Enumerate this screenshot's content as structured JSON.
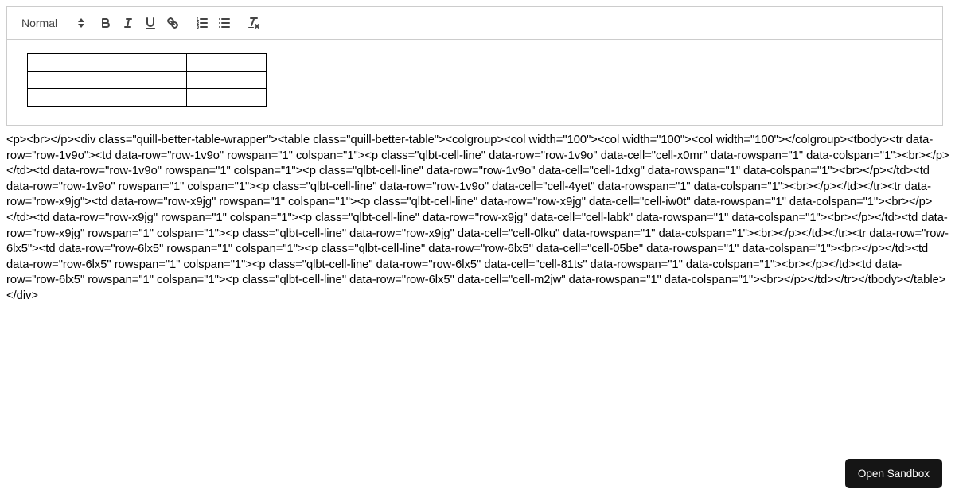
{
  "editor": {
    "toolbar": {
      "format_picker": {
        "label": "Normal",
        "icon": "chevron-updown-icon"
      },
      "buttons": [
        {
          "name": "bold",
          "label": "B",
          "icon": "bold-icon"
        },
        {
          "name": "italic",
          "label": "I",
          "icon": "italic-icon"
        },
        {
          "name": "underline",
          "label": "U",
          "icon": "underline-icon"
        },
        {
          "name": "link",
          "label": "Link",
          "icon": "link-icon"
        },
        {
          "name": "ordered-list",
          "label": "Ordered List",
          "icon": "list-ordered-icon"
        },
        {
          "name": "bullet-list",
          "label": "Bullet List",
          "icon": "list-bullet-icon"
        },
        {
          "name": "clean",
          "label": "Clear Formatting",
          "icon": "clear-format-icon"
        }
      ]
    },
    "content": {
      "table": {
        "rows": 3,
        "cols": 3,
        "col_width": "100",
        "cells": [
          [
            "",
            "",
            ""
          ],
          [
            "",
            "",
            ""
          ],
          [
            "",
            "",
            ""
          ]
        ]
      }
    }
  },
  "output": {
    "html_source": "<p><br></p><div class=\"quill-better-table-wrapper\"><table class=\"quill-better-table\"><colgroup><col width=\"100\"><col width=\"100\"><col width=\"100\"></colgroup><tbody><tr data-row=\"row-1v9o\"><td data-row=\"row-1v9o\" rowspan=\"1\" colspan=\"1\"><p class=\"qlbt-cell-line\" data-row=\"row-1v9o\" data-cell=\"cell-x0mr\" data-rowspan=\"1\" data-colspan=\"1\"><br></p></td><td data-row=\"row-1v9o\" rowspan=\"1\" colspan=\"1\"><p class=\"qlbt-cell-line\" data-row=\"row-1v9o\" data-cell=\"cell-1dxg\" data-rowspan=\"1\" data-colspan=\"1\"><br></p></td><td data-row=\"row-1v9o\" rowspan=\"1\" colspan=\"1\"><p class=\"qlbt-cell-line\" data-row=\"row-1v9o\" data-cell=\"cell-4yet\" data-rowspan=\"1\" data-colspan=\"1\"><br></p></td></tr><tr data-row=\"row-x9jg\"><td data-row=\"row-x9jg\" rowspan=\"1\" colspan=\"1\"><p class=\"qlbt-cell-line\" data-row=\"row-x9jg\" data-cell=\"cell-iw0t\" data-rowspan=\"1\" data-colspan=\"1\"><br></p></td><td data-row=\"row-x9jg\" rowspan=\"1\" colspan=\"1\"><p class=\"qlbt-cell-line\" data-row=\"row-x9jg\" data-cell=\"cell-labk\" data-rowspan=\"1\" data-colspan=\"1\"><br></p></td><td data-row=\"row-x9jg\" rowspan=\"1\" colspan=\"1\"><p class=\"qlbt-cell-line\" data-row=\"row-x9jg\" data-cell=\"cell-0lku\" data-rowspan=\"1\" data-colspan=\"1\"><br></p></td></tr><tr data-row=\"row-6lx5\"><td data-row=\"row-6lx5\" rowspan=\"1\" colspan=\"1\"><p class=\"qlbt-cell-line\" data-row=\"row-6lx5\" data-cell=\"cell-05be\" data-rowspan=\"1\" data-colspan=\"1\"><br></p></td><td data-row=\"row-6lx5\" rowspan=\"1\" colspan=\"1\"><p class=\"qlbt-cell-line\" data-row=\"row-6lx5\" data-cell=\"cell-81ts\" data-rowspan=\"1\" data-colspan=\"1\"><br></p></td><td data-row=\"row-6lx5\" rowspan=\"1\" colspan=\"1\"><p class=\"qlbt-cell-line\" data-row=\"row-6lx5\" data-cell=\"cell-m2jw\" data-rowspan=\"1\" data-colspan=\"1\"><br></p></td></tr></tbody></table></div>"
  },
  "sandbox": {
    "button_label": "Open Sandbox"
  },
  "colors": {
    "toolbar_icon": "#444444",
    "border": "#cccccc",
    "table_border": "#000000",
    "sandbox_bg": "#151515",
    "sandbox_text": "#ffffff",
    "page_bg": "#ffffff"
  }
}
